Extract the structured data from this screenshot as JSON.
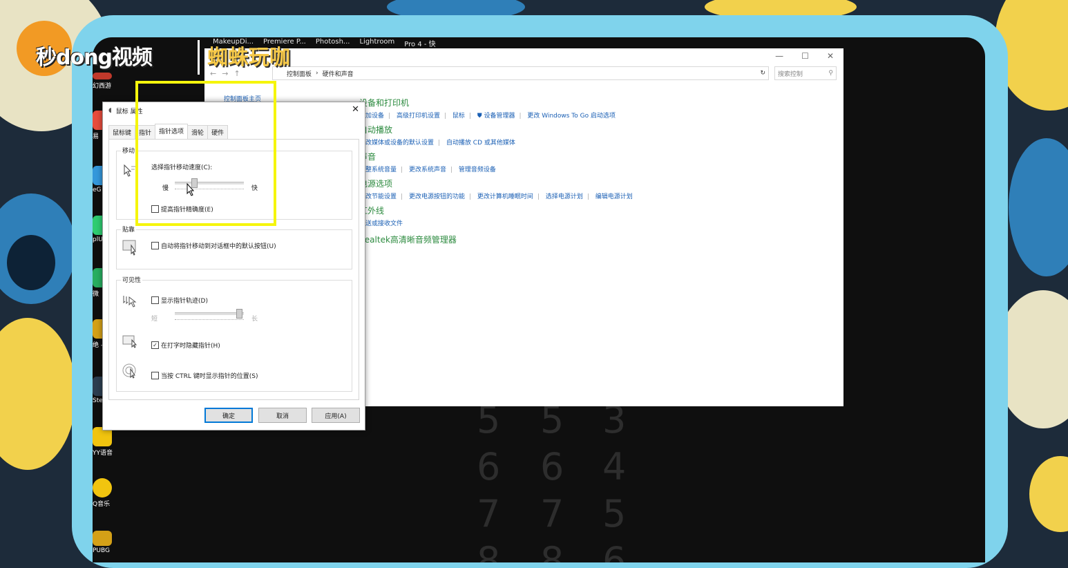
{
  "watermark": {
    "brand": "秒dong视频",
    "partner": "蜘蛛玩咖"
  },
  "taskbar": {
    "windows": [
      "MakeupDi...",
      "Premiere P...",
      "Photosh...",
      "Lightroom",
      "Pro 4 - 快"
    ]
  },
  "desktop_icons": [
    {
      "label": "幻西游",
      "color": "#c0392b"
    },
    {
      "label": "易",
      "color": "#e74c3c"
    },
    {
      "label": "eG",
      "color": "#3498db"
    },
    {
      "label": "plU",
      "color": "#2ecc71"
    },
    {
      "label": "微",
      "color": "#27ae60"
    },
    {
      "label": "绝\n-G",
      "color": "#d4a017"
    },
    {
      "label": "Ste",
      "color": "#2c3e50"
    },
    {
      "label": "YY语音",
      "color": "#f1c40f"
    },
    {
      "label": "Q音乐",
      "color": "#f1c40f"
    },
    {
      "label": "PUBG",
      "color": "#d4a017"
    }
  ],
  "background_digits": {
    "col1": [
      "5",
      "6",
      "7",
      "8"
    ],
    "col2": [
      "5",
      "6",
      "7",
      "8"
    ],
    "col3": [
      "3",
      "4",
      "5",
      "6"
    ]
  },
  "control_panel": {
    "nav": {
      "back": "←",
      "forward": "→",
      "up": "↑"
    },
    "breadcrumb": [
      "控制面板",
      "硬件和声音"
    ],
    "refresh": "↻",
    "search_placeholder": "搜索控制",
    "left_nav_home": "控制面板主页",
    "sections": [
      {
        "heading": "设备和打印机",
        "links": [
          "添加设备",
          "高级打印机设置",
          "鼠标",
          "设备管理器",
          "更改 Windows To Go 启动选项"
        ]
      },
      {
        "heading": "自动播放",
        "links": [
          "更改媒体或设备的默认设置",
          "自动播放 CD 或其他媒体"
        ]
      },
      {
        "heading": "声音",
        "links": [
          "调整系统音量",
          "更改系统声音",
          "管理音频设备"
        ]
      },
      {
        "heading": "电源选项",
        "links": [
          "更改节能设置",
          "更改电源按钮的功能",
          "更改计算机睡眠时间",
          "选择电源计划",
          "编辑电源计划"
        ]
      },
      {
        "heading": "红外线",
        "links": [
          "发送或接收文件"
        ]
      },
      {
        "heading": "Realtek高清晰音频管理器",
        "links": []
      }
    ]
  },
  "mouse_dialog": {
    "title": "鼠标 属性",
    "close": "✕",
    "tabs": [
      "鼠标键",
      "指针",
      "指针选项",
      "滑轮",
      "硬件"
    ],
    "active_tab": "指针选项",
    "motion": {
      "group_label": "移动",
      "speed_label": "选择指针移动速度(C):",
      "slow": "慢",
      "fast": "快",
      "speed_level": 0.25,
      "enhance_precision": {
        "label": "提高指针精确度(E)",
        "checked": false
      }
    },
    "snap_to": {
      "group_label": "贴靠",
      "option": {
        "label": "自动将指针移动到对话框中的默认按钮(U)",
        "checked": false
      }
    },
    "visibility": {
      "group_label": "可见性",
      "trails": {
        "label": "显示指针轨迹(D)",
        "checked": false
      },
      "short": "短",
      "long": "长",
      "trail_level": 0.95,
      "hide_typing": {
        "label": "在打字时隐藏指针(H)",
        "checked": true
      },
      "show_ctrl": {
        "label": "当按 CTRL 键时显示指针的位置(S)",
        "checked": false
      }
    },
    "buttons": {
      "ok": "确定",
      "cancel": "取消",
      "apply": "应用(A)"
    }
  },
  "colors": {
    "frame": "#7fd3ec",
    "highlight": "#f5f50c",
    "link": "#1a5fb4",
    "heading": "#2b8a3e"
  }
}
